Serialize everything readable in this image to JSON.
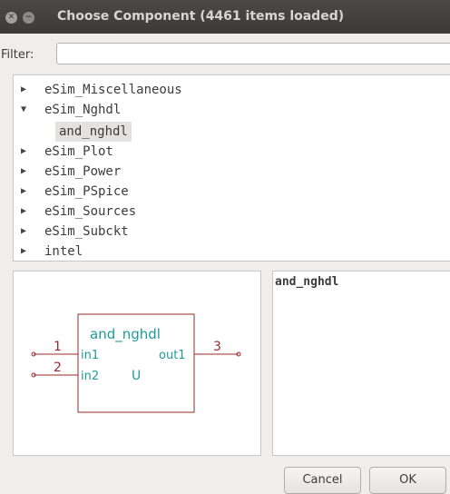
{
  "window": {
    "title": "Choose Component (4461 items loaded)",
    "close_glyph": "✕",
    "minimize_glyph": "−"
  },
  "filter": {
    "label": "Filter:",
    "value": "",
    "placeholder": ""
  },
  "tree": {
    "items": [
      {
        "label": "eSim_Miscellaneous",
        "expanded": false
      },
      {
        "label": "eSim_Nghdl",
        "expanded": true,
        "children": [
          {
            "label": "and_nghdl",
            "selected": true
          }
        ]
      },
      {
        "label": "eSim_Plot",
        "expanded": false
      },
      {
        "label": "eSim_Power",
        "expanded": false
      },
      {
        "label": "eSim_PSpice",
        "expanded": false
      },
      {
        "label": "eSim_Sources",
        "expanded": false
      },
      {
        "label": "eSim_Subckt",
        "expanded": false
      },
      {
        "label": "intel",
        "expanded": false
      }
    ]
  },
  "preview": {
    "component_name": "and_nghdl",
    "pins": {
      "pin1_number": "1",
      "pin1_name": "in1",
      "pin2_number": "2",
      "pin2_name": "in2",
      "pin3_number": "3",
      "pin3_name": "out1"
    },
    "reference": "U",
    "colors": {
      "body": "#9c2a2a",
      "text": "#1e9a9a",
      "pin": "#9c2a2a"
    }
  },
  "description": {
    "text": "and_nghdl"
  },
  "buttons": {
    "cancel": "Cancel",
    "ok": "OK"
  }
}
